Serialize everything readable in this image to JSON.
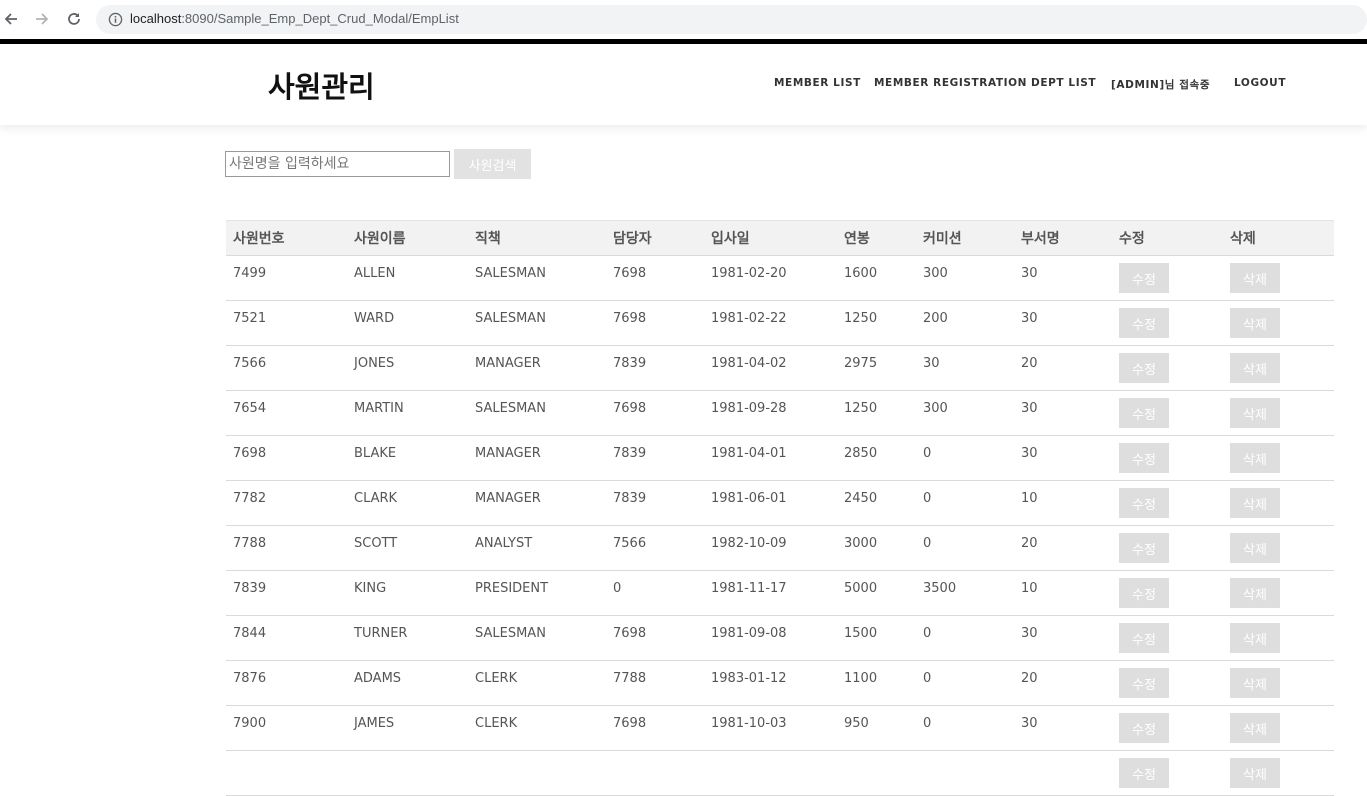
{
  "browser": {
    "url_host": "localhost",
    "url_rest": ":8090/Sample_Emp_Dept_Crud_Modal/EmpList"
  },
  "header": {
    "title": "사원관리",
    "menu": [
      "MEMBER LIST",
      "MEMBER REGISTRATION",
      "DEPT LIST",
      "[ADMIN]님 접속중",
      "LOGOUT"
    ]
  },
  "search": {
    "placeholder": "사원명을 입력하세요",
    "button_label": "사원검색"
  },
  "table": {
    "headers": [
      "사원번호",
      "사원이름",
      "직책",
      "담당자",
      "입사일",
      "연봉",
      "커미션",
      "부서명",
      "수정",
      "삭제"
    ],
    "edit_label": "수정",
    "delete_label": "삭제",
    "rows": [
      [
        "7499",
        "ALLEN",
        "SALESMAN",
        "7698",
        "1981-02-20",
        "1600",
        "300",
        "30"
      ],
      [
        "7521",
        "WARD",
        "SALESMAN",
        "7698",
        "1981-02-22",
        "1250",
        "200",
        "30"
      ],
      [
        "7566",
        "JONES",
        "MANAGER",
        "7839",
        "1981-04-02",
        "2975",
        "30",
        "20"
      ],
      [
        "7654",
        "MARTIN",
        "SALESMAN",
        "7698",
        "1981-09-28",
        "1250",
        "300",
        "30"
      ],
      [
        "7698",
        "BLAKE",
        "MANAGER",
        "7839",
        "1981-04-01",
        "2850",
        "0",
        "30"
      ],
      [
        "7782",
        "CLARK",
        "MANAGER",
        "7839",
        "1981-06-01",
        "2450",
        "0",
        "10"
      ],
      [
        "7788",
        "SCOTT",
        "ANALYST",
        "7566",
        "1982-10-09",
        "3000",
        "0",
        "20"
      ],
      [
        "7839",
        "KING",
        "PRESIDENT",
        "0",
        "1981-11-17",
        "5000",
        "3500",
        "10"
      ],
      [
        "7844",
        "TURNER",
        "SALESMAN",
        "7698",
        "1981-09-08",
        "1500",
        "0",
        "30"
      ],
      [
        "7876",
        "ADAMS",
        "CLERK",
        "7788",
        "1983-01-12",
        "1100",
        "0",
        "20"
      ],
      [
        "7900",
        "JAMES",
        "CLERK",
        "7698",
        "1981-10-03",
        "950",
        "0",
        "30"
      ],
      [
        "",
        "",
        "",
        "",
        "",
        "",
        "",
        ""
      ]
    ]
  }
}
